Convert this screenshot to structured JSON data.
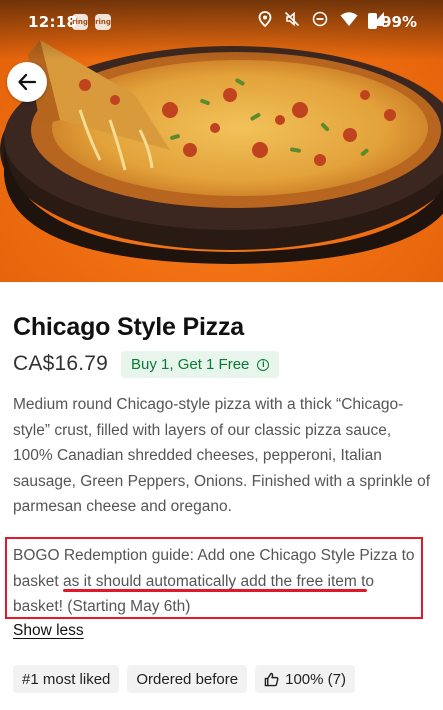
{
  "status_bar": {
    "time": "12:18",
    "notification_icons": [
      "ring",
      "ring"
    ],
    "system_icons": [
      "location-icon",
      "mute-icon",
      "dnd-icon",
      "wifi-icon",
      "signal-icon",
      "battery-icon"
    ],
    "battery": "99%"
  },
  "hero": {
    "image": "pizza-photo",
    "accent": "#ef6d10"
  },
  "item": {
    "title": "Chicago Style Pizza",
    "price": "CA$16.79",
    "promo_label": "Buy 1, Get 1 Free",
    "description": "Medium round Chicago-style pizza with a thick “Chicago-style” crust, filled with layers of our classic pizza sauce, 100% Canadian shredded cheeses, pepperoni, Italian sausage, Green Peppers, Onions. Finished with a sprinkle of parmesan cheese and oregano.",
    "bogo_part1": "BOGO Redemption guide: Add one Chicago Style Pizza to basket ",
    "bogo_part2": "as it should automatically add the free item",
    "bogo_part3": " to basket! (Starting May 6th)",
    "show_less": "Show less"
  },
  "chips": [
    {
      "label": "#1 most liked"
    },
    {
      "label": "Ordered before"
    },
    {
      "label": "100% (7)",
      "icon": "thumbs-up-icon"
    }
  ],
  "colors": {
    "promo_bg": "#e8f5ec",
    "promo_text": "#0b7a35",
    "annotation_red": "#e0182a"
  }
}
